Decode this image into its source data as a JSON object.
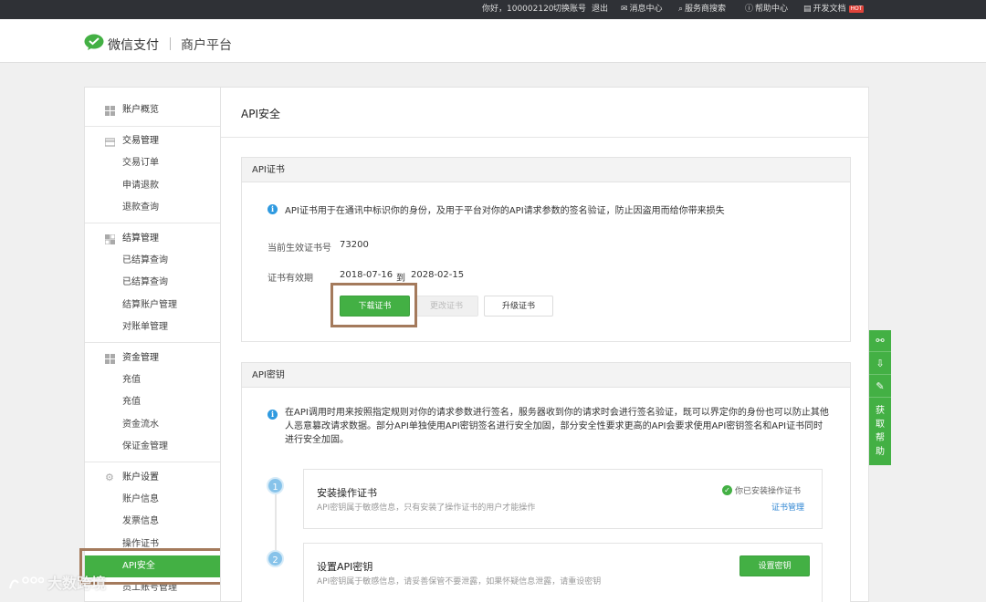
{
  "topbar": {
    "greeting": "你好，100002120",
    "switch_account": "切换账号",
    "logout": "退出",
    "message_center": "消息中心",
    "service_search": "服务商搜索",
    "help_center": "帮助中心",
    "dev_docs": "开发文档",
    "hot_badge": "HOT"
  },
  "header": {
    "brand": "微信支付",
    "platform": "商户平台"
  },
  "sidebar": {
    "account_overview": "账户概览",
    "trade": {
      "label": "交易管理",
      "items": [
        "交易订单",
        "申请退款",
        "退款查询"
      ]
    },
    "settlement": {
      "label": "结算管理",
      "items": [
        "已结算查询",
        "已结算查询",
        "结算账户管理",
        "对账单管理"
      ]
    },
    "funds": {
      "label": "资金管理",
      "items": [
        "充值",
        "充值",
        "资金流水",
        "保证金管理"
      ]
    },
    "settings": {
      "label": "账户设置",
      "items": [
        "账户信息",
        "发票信息",
        "操作证书",
        "API安全",
        "员工账号管理"
      ]
    }
  },
  "main": {
    "title": "API安全",
    "cert": {
      "heading": "API证书",
      "info": "API证书用于在通讯中标识你的身份，及用于平台对你的API请求参数的签名验证，防止因盗用而给你带来损失",
      "serial_label": "当前生效证书号",
      "serial_value": "73200",
      "validity_label": "证书有效期",
      "valid_from": "2018-07-16",
      "to_word": "到",
      "valid_to": "2028-02-15",
      "download_button": "下载证书",
      "change_button": "更改证书",
      "upgrade_button": "升级证书"
    },
    "key": {
      "heading": "API密钥",
      "info": "在API调用时用来按照指定规则对你的请求参数进行签名，服务器收到你的请求时会进行签名验证，既可以界定你的身份也可以防止其他人恶意篡改请求数据。部分API单独使用API密钥签名进行安全加固，部分安全性要求更高的API会要求使用API密钥签名和API证书同时进行安全加固。",
      "steps": [
        {
          "number": "1",
          "title": "安装操作证书",
          "desc": "API密钥属于敏感信息，只有安装了操作证书的用户才能操作",
          "status": "你已安装操作证书",
          "link": "证书管理"
        },
        {
          "number": "2",
          "title": "设置API密钥",
          "desc": "API密钥属于敏感信息，请妥善保管不要泄露，如果怀疑信息泄露，请重设密钥",
          "button": "设置密钥"
        }
      ]
    }
  },
  "float_bar": {
    "help_text": "获取帮助"
  },
  "watermark": "大数跨境",
  "colors": {
    "accent_green": "#43b044",
    "highlight_box": "#a47a5c",
    "info_blue": "#2f9ae0",
    "link_blue": "#2f86d3"
  }
}
